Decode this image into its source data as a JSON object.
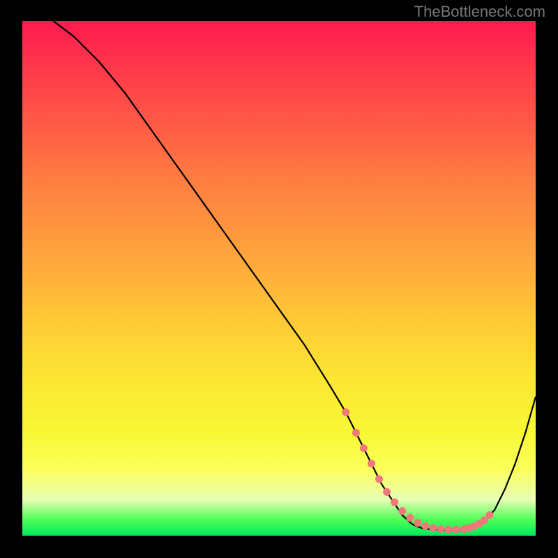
{
  "watermark": "TheBottleneck.com",
  "chart_data": {
    "type": "line",
    "title": "",
    "xlabel": "",
    "ylabel": "",
    "xlim": [
      0,
      100
    ],
    "ylim": [
      0,
      100
    ],
    "grid": false,
    "legend": false,
    "series": [
      {
        "name": "curve",
        "x": [
          6,
          10,
          15,
          20,
          25,
          30,
          35,
          40,
          45,
          50,
          55,
          60,
          63,
          66,
          68,
          70,
          72,
          74,
          76,
          78,
          80,
          82,
          84,
          86,
          88,
          90,
          92,
          94,
          96,
          98,
          100
        ],
        "y": [
          100,
          97,
          92,
          86,
          79,
          72,
          65,
          58,
          51,
          44,
          37,
          29,
          24,
          18,
          14,
          10,
          7,
          4,
          2.2,
          1.4,
          1.2,
          1.1,
          1.1,
          1.2,
          1.7,
          2.8,
          5,
          9,
          14,
          20,
          27
        ],
        "color": "#000000"
      }
    ],
    "markers": {
      "name": "highlight-dots",
      "x": [
        63,
        65,
        66.5,
        68,
        69.5,
        71,
        72.5,
        74,
        75.5,
        77,
        78.5,
        80,
        81.5,
        83,
        84.5,
        86,
        87,
        88,
        89,
        90,
        91
      ],
      "y": [
        24,
        20,
        17,
        14,
        11,
        8.5,
        6.5,
        4.8,
        3.5,
        2.5,
        1.9,
        1.5,
        1.3,
        1.2,
        1.2,
        1.3,
        1.5,
        1.8,
        2.3,
        3,
        4
      ],
      "color": "#f07878"
    },
    "gradient_stops": [
      {
        "pos": 0,
        "color": "#ff1a4e"
      },
      {
        "pos": 50,
        "color": "#ffb13a"
      },
      {
        "pos": 80,
        "color": "#f8f734"
      },
      {
        "pos": 97,
        "color": "#4cff55"
      },
      {
        "pos": 100,
        "color": "#00e85e"
      }
    ]
  }
}
